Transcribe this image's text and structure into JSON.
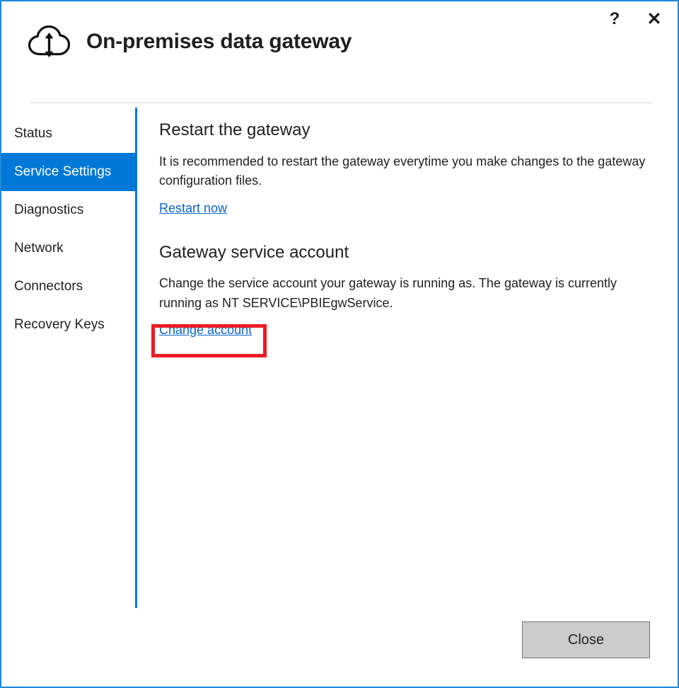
{
  "window": {
    "title": "On-premises data gateway",
    "logo_icon": "cloud-sync-icon",
    "help_label": "?",
    "close_label": "✕",
    "accent_color": "#0078d7",
    "border_color": "#1b8ae0",
    "link_color": "#0a64c8",
    "highlight_color": "#ec1c24"
  },
  "sidebar": {
    "items": [
      {
        "label": "Status",
        "selected": false
      },
      {
        "label": "Service Settings",
        "selected": true
      },
      {
        "label": "Diagnostics",
        "selected": false
      },
      {
        "label": "Network",
        "selected": false
      },
      {
        "label": "Connectors",
        "selected": false
      },
      {
        "label": "Recovery Keys",
        "selected": false
      }
    ]
  },
  "main": {
    "sections": [
      {
        "title": "Restart the gateway",
        "body": "It is recommended to restart the gateway everytime you make changes to the gateway configuration files.",
        "link": "Restart now"
      },
      {
        "title": "Gateway service account",
        "body": "Change the service account your gateway is running as. The gateway is currently running as NT SERVICE\\PBIEgwService.",
        "link": "Change account"
      }
    ]
  },
  "footer": {
    "close_label": "Close"
  }
}
